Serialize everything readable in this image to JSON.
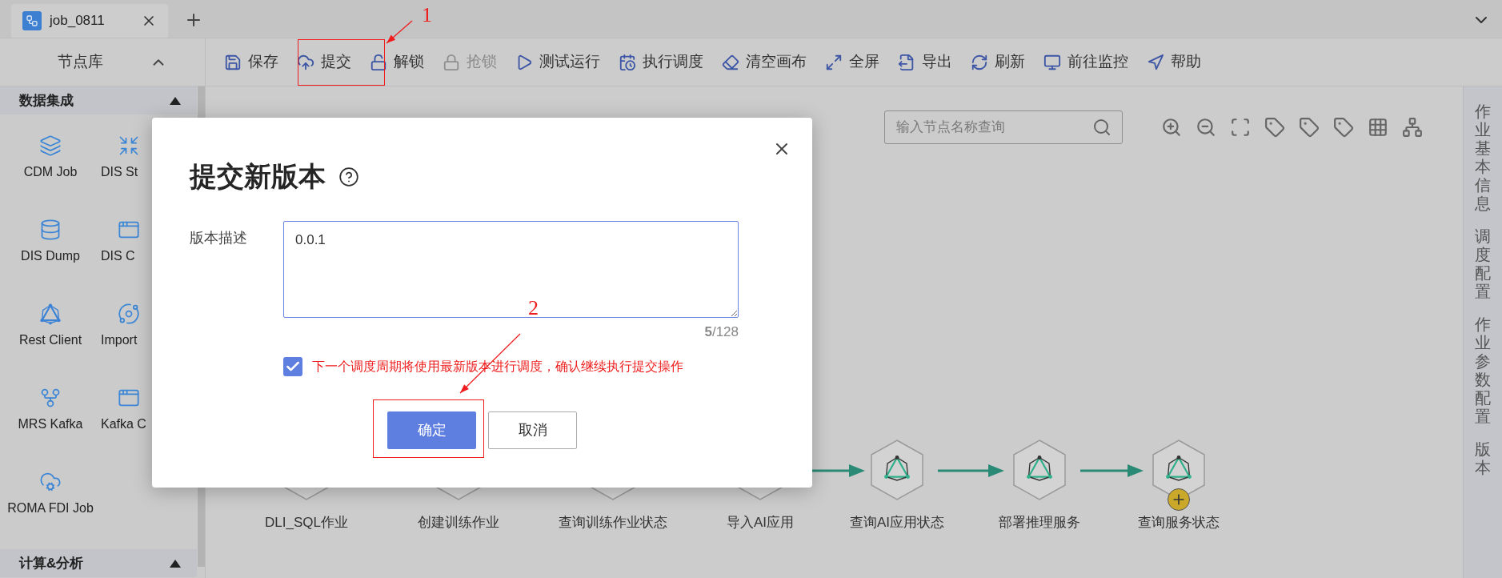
{
  "tabs": [
    {
      "label": "job_0811",
      "selected": true
    }
  ],
  "toolbar": {
    "panel_title": "节点库",
    "buttons": [
      {
        "label": "保存",
        "disabled": false
      },
      {
        "label": "提交",
        "disabled": false
      },
      {
        "label": "解锁",
        "disabled": false
      },
      {
        "label": "抢锁",
        "disabled": true
      },
      {
        "label": "测试运行",
        "disabled": false
      },
      {
        "label": "执行调度",
        "disabled": false
      },
      {
        "label": "清空画布",
        "disabled": false
      },
      {
        "label": "全屏",
        "disabled": false
      },
      {
        "label": "导出",
        "disabled": false
      },
      {
        "label": "刷新",
        "disabled": false
      },
      {
        "label": "前往监控",
        "disabled": false
      },
      {
        "label": "帮助",
        "disabled": false
      }
    ]
  },
  "sidebar": {
    "sections": [
      {
        "title": "数据集成",
        "expanded": true,
        "items": [
          "CDM Job",
          "DIS St",
          "DIS Dump",
          "DIS C",
          "Rest Client",
          "Import",
          "MRS Kafka",
          "Kafka C",
          "ROMA FDI Job"
        ]
      },
      {
        "title": "计算&分析",
        "expanded": true
      }
    ]
  },
  "canvas": {
    "search": {
      "placeholder": "输入节点名称查询"
    },
    "nodes": [
      {
        "label": "DLI_SQL作业",
        "add_handle": false
      },
      {
        "label": "创建训练作业",
        "add_handle": false
      },
      {
        "label": "查询训练作业状态",
        "add_handle": false
      },
      {
        "label": "导入AI应用",
        "add_handle": false
      },
      {
        "label": "查询AI应用状态",
        "add_handle": false
      },
      {
        "label": "部署推理服务",
        "add_handle": false
      },
      {
        "label": "查询服务状态",
        "add_handle": true
      }
    ]
  },
  "right_panel": {
    "tabs": [
      "作业基本信息",
      "调度配置",
      "作业参数配置",
      "版本"
    ]
  },
  "dialog": {
    "title": "提交新版本",
    "field_label": "版本描述",
    "value": "0.0.1",
    "counter": "**5**/128",
    "confirm": {
      "checked": true,
      "text": "下一个调度周期将使用最新版本进行调度，确认继续执行提交操作"
    },
    "buttons": [
      {
        "label": "确定",
        "kind": "primary"
      },
      {
        "label": "取消",
        "kind": "default"
      }
    ]
  },
  "annotations": [
    {
      "label": "1"
    },
    {
      "label": "2"
    }
  ]
}
